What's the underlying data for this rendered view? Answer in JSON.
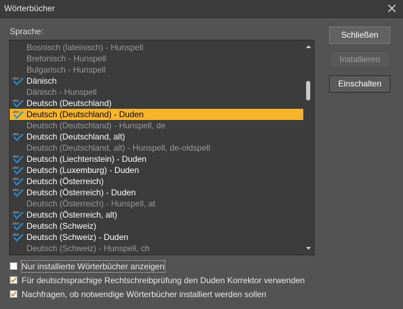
{
  "window": {
    "title": "Wörterbücher"
  },
  "language_label": "Sprache:",
  "dictionaries": [
    {
      "label": "Bosnisch (lateinisch) - Hunspell",
      "state": "inactive",
      "icon": ""
    },
    {
      "label": "Bretonisch - Hunspell",
      "state": "inactive",
      "icon": ""
    },
    {
      "label": "Bulgarisch - Hunspell",
      "state": "inactive",
      "icon": ""
    },
    {
      "label": "Dänisch",
      "state": "active",
      "icon": "abc-check-icon"
    },
    {
      "label": "Dänisch - Hunspell",
      "state": "inactive",
      "icon": ""
    },
    {
      "label": "Deutsch (Deutschland)",
      "state": "active",
      "icon": "abc-check-icon"
    },
    {
      "label": "Deutsch (Deutschland) - Duden",
      "state": "selected",
      "icon": "abc-check-icon"
    },
    {
      "label": "Deutsch (Deutschland) - Hunspell, de",
      "state": "inactive",
      "icon": ""
    },
    {
      "label": "Deutsch (Deutschland, alt)",
      "state": "active",
      "icon": "abc-check-icon"
    },
    {
      "label": "Deutsch (Deutschland, alt) - Hunspell, de-oldspell",
      "state": "inactive",
      "icon": ""
    },
    {
      "label": "Deutsch (Liechtenstein) - Duden",
      "state": "active",
      "icon": "abc-check-icon"
    },
    {
      "label": "Deutsch (Luxemburg) - Duden",
      "state": "active",
      "icon": "abc-check-icon"
    },
    {
      "label": "Deutsch (Österreich)",
      "state": "active",
      "icon": "abc-check-icon"
    },
    {
      "label": "Deutsch (Österreich) - Duden",
      "state": "active",
      "icon": "abc-check-icon"
    },
    {
      "label": "Deutsch (Österreich) - Hunspell, at",
      "state": "inactive",
      "icon": ""
    },
    {
      "label": "Deutsch (Österreich, alt)",
      "state": "active",
      "icon": "abc-check-icon"
    },
    {
      "label": "Deutsch (Schweiz)",
      "state": "active",
      "icon": "abc-check-icon"
    },
    {
      "label": "Deutsch (Schweiz) - Duden",
      "state": "active",
      "icon": "abc-check-icon"
    },
    {
      "label": "Deutsch (Schweiz) - Hunspell, ch",
      "state": "inactive",
      "icon": ""
    }
  ],
  "buttons": {
    "close": {
      "label": "Schließen",
      "accel": "l"
    },
    "install": {
      "label": "Installieren",
      "accel": "I"
    },
    "enable": {
      "label": "Einschalten",
      "accel": "E"
    }
  },
  "options": [
    {
      "label": "Nur installierte Wörterbücher anzeigen",
      "checked": false,
      "focused": true
    },
    {
      "label": "Für deutschsprachige Rechtschreibprüfung den Duden Korrektor verwenden",
      "checked": true,
      "focused": false
    },
    {
      "label": "Nachfragen, ob notwendige Wörterbücher installiert werden sollen",
      "checked": true,
      "focused": false
    }
  ],
  "colors": {
    "selection": "#f7b52c",
    "check": "#1e8fe0",
    "checkbox_mark": "#e0841a"
  }
}
